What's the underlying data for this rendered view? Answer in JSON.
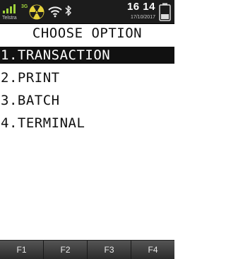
{
  "status_bar": {
    "carrier": "Telstra",
    "network_type": "3G",
    "time": "16 14",
    "date": "17/10/2017",
    "icons": [
      "signal-bars-icon",
      "radiation-icon",
      "wifi-icon",
      "bluetooth-icon",
      "battery-icon"
    ],
    "battery_level": 0.35
  },
  "title": "CHOOSE OPTION",
  "menu": {
    "selected_index": 0,
    "items": [
      {
        "label": "1.TRANSACTION"
      },
      {
        "label": "2.PRINT"
      },
      {
        "label": "3.BATCH"
      },
      {
        "label": "4.TERMINAL"
      }
    ]
  },
  "function_keys": [
    {
      "label": "F1"
    },
    {
      "label": "F2"
    },
    {
      "label": "F3"
    },
    {
      "label": "F4"
    }
  ],
  "colors": {
    "status_bar_bg": "#1c1c1c",
    "highlight_bg": "#111111",
    "highlight_text": "#ffffff",
    "network_accent": "#9fd23b",
    "radiation_icon": "#e6d23a"
  }
}
